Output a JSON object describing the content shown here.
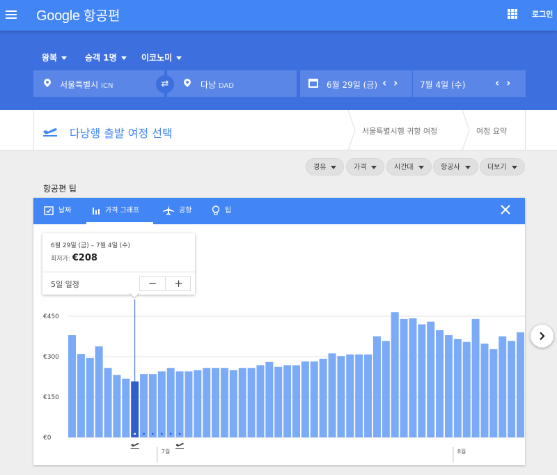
{
  "app": {
    "brand_google": "Google",
    "brand_product": "항공편",
    "login": "로그인"
  },
  "search": {
    "trip_type": "왕복",
    "passengers": "승객 1명",
    "cabin": "이코노미",
    "origin": {
      "city": "서울특별시",
      "code": "ICN"
    },
    "destination": {
      "city": "다낭",
      "code": "DAD"
    },
    "depart_date": "6월 29일 (금)",
    "return_date": "7월 4일 (수)"
  },
  "steps": {
    "current": "다낭행 출발 여정 선택",
    "return": "서울특별시행 귀항 여정",
    "summary": "여정 요약"
  },
  "filters": [
    "경유",
    "가격",
    "시간대",
    "항공사",
    "더보기"
  ],
  "tips": {
    "section_label": "항공편 팁",
    "tabs": [
      "날짜",
      "가격 그래프",
      "공항",
      "팁"
    ],
    "active_tab": 1
  },
  "popup": {
    "dates": "6월 29일 (금) – 7월 4일 (수)",
    "lowest_label": "최저가:",
    "lowest_price": "€208",
    "trip_length": "5일 일정",
    "minus": "−",
    "plus": "+"
  },
  "chart_data": {
    "type": "bar",
    "yticks": [
      "€0",
      "€150",
      "€300",
      "€450"
    ],
    "ylim": [
      0,
      500
    ],
    "values": [
      380,
      310,
      295,
      338,
      258,
      232,
      218,
      208,
      235,
      235,
      245,
      258,
      245,
      245,
      250,
      258,
      258,
      258,
      250,
      258,
      258,
      268,
      280,
      262,
      268,
      268,
      282,
      282,
      292,
      312,
      302,
      308,
      308,
      308,
      375,
      358,
      465,
      440,
      442,
      420,
      430,
      398,
      380,
      365,
      355,
      440,
      348,
      328,
      375,
      358,
      390,
      360
    ],
    "selected_index": 7,
    "trip_days": 5,
    "month_labels": [
      {
        "index": 10,
        "label": "7월"
      },
      {
        "index": 43,
        "label": "8월"
      }
    ],
    "colors": {
      "bar": "#7baaf7",
      "selected": "#2f5fce",
      "grid": "#e0e0e0"
    }
  }
}
